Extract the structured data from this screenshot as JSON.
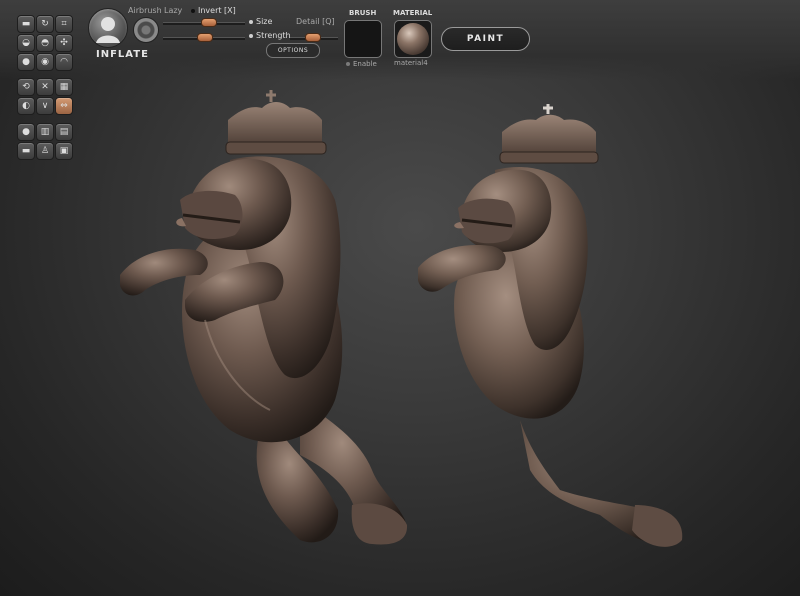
{
  "brush": {
    "name": "INFLATE",
    "icon": "brush-head-icon"
  },
  "controls": {
    "airbrush_label": "Airbrush",
    "lazy_label": "Lazy",
    "invert_label": "Invert [X]",
    "size_label": "Size",
    "strength_label": "Strength",
    "detail_label": "Detail [Q]",
    "options_label": "OPTIONS",
    "size_level": 0.55,
    "strength_level": 0.5,
    "detail_level": 0.45
  },
  "brush_slot": {
    "heading": "BRUSH",
    "enable_label": "Enable"
  },
  "material_slot": {
    "heading": "MATERIAL",
    "name": "material4"
  },
  "paint_button": {
    "label": "PAINT"
  },
  "tools": [
    {
      "icon": "brush-icon"
    },
    {
      "icon": "rotate-icon"
    },
    {
      "icon": "crop-icon"
    },
    {
      "icon": "smooth-icon"
    },
    {
      "icon": "inflate-icon"
    },
    {
      "icon": "pinch-icon"
    },
    {
      "icon": "user-icon"
    },
    {
      "icon": "layer-icon"
    },
    {
      "icon": "flatten-icon"
    },
    {
      "icon": "sync-icon"
    },
    {
      "icon": "cross-icon"
    },
    {
      "icon": "grid-icon"
    },
    {
      "icon": "mirror-icon"
    },
    {
      "icon": "wave-icon"
    },
    {
      "icon": "symmetry-icon"
    },
    {
      "icon": "sphere-icon"
    },
    {
      "icon": "chart-icon"
    },
    {
      "icon": "stack-icon"
    },
    {
      "icon": "minus-icon"
    },
    {
      "icon": "figure-icon"
    },
    {
      "icon": "archive-icon"
    }
  ],
  "colors": {
    "accent": "#c58a62",
    "model": "#6f5a4e"
  }
}
